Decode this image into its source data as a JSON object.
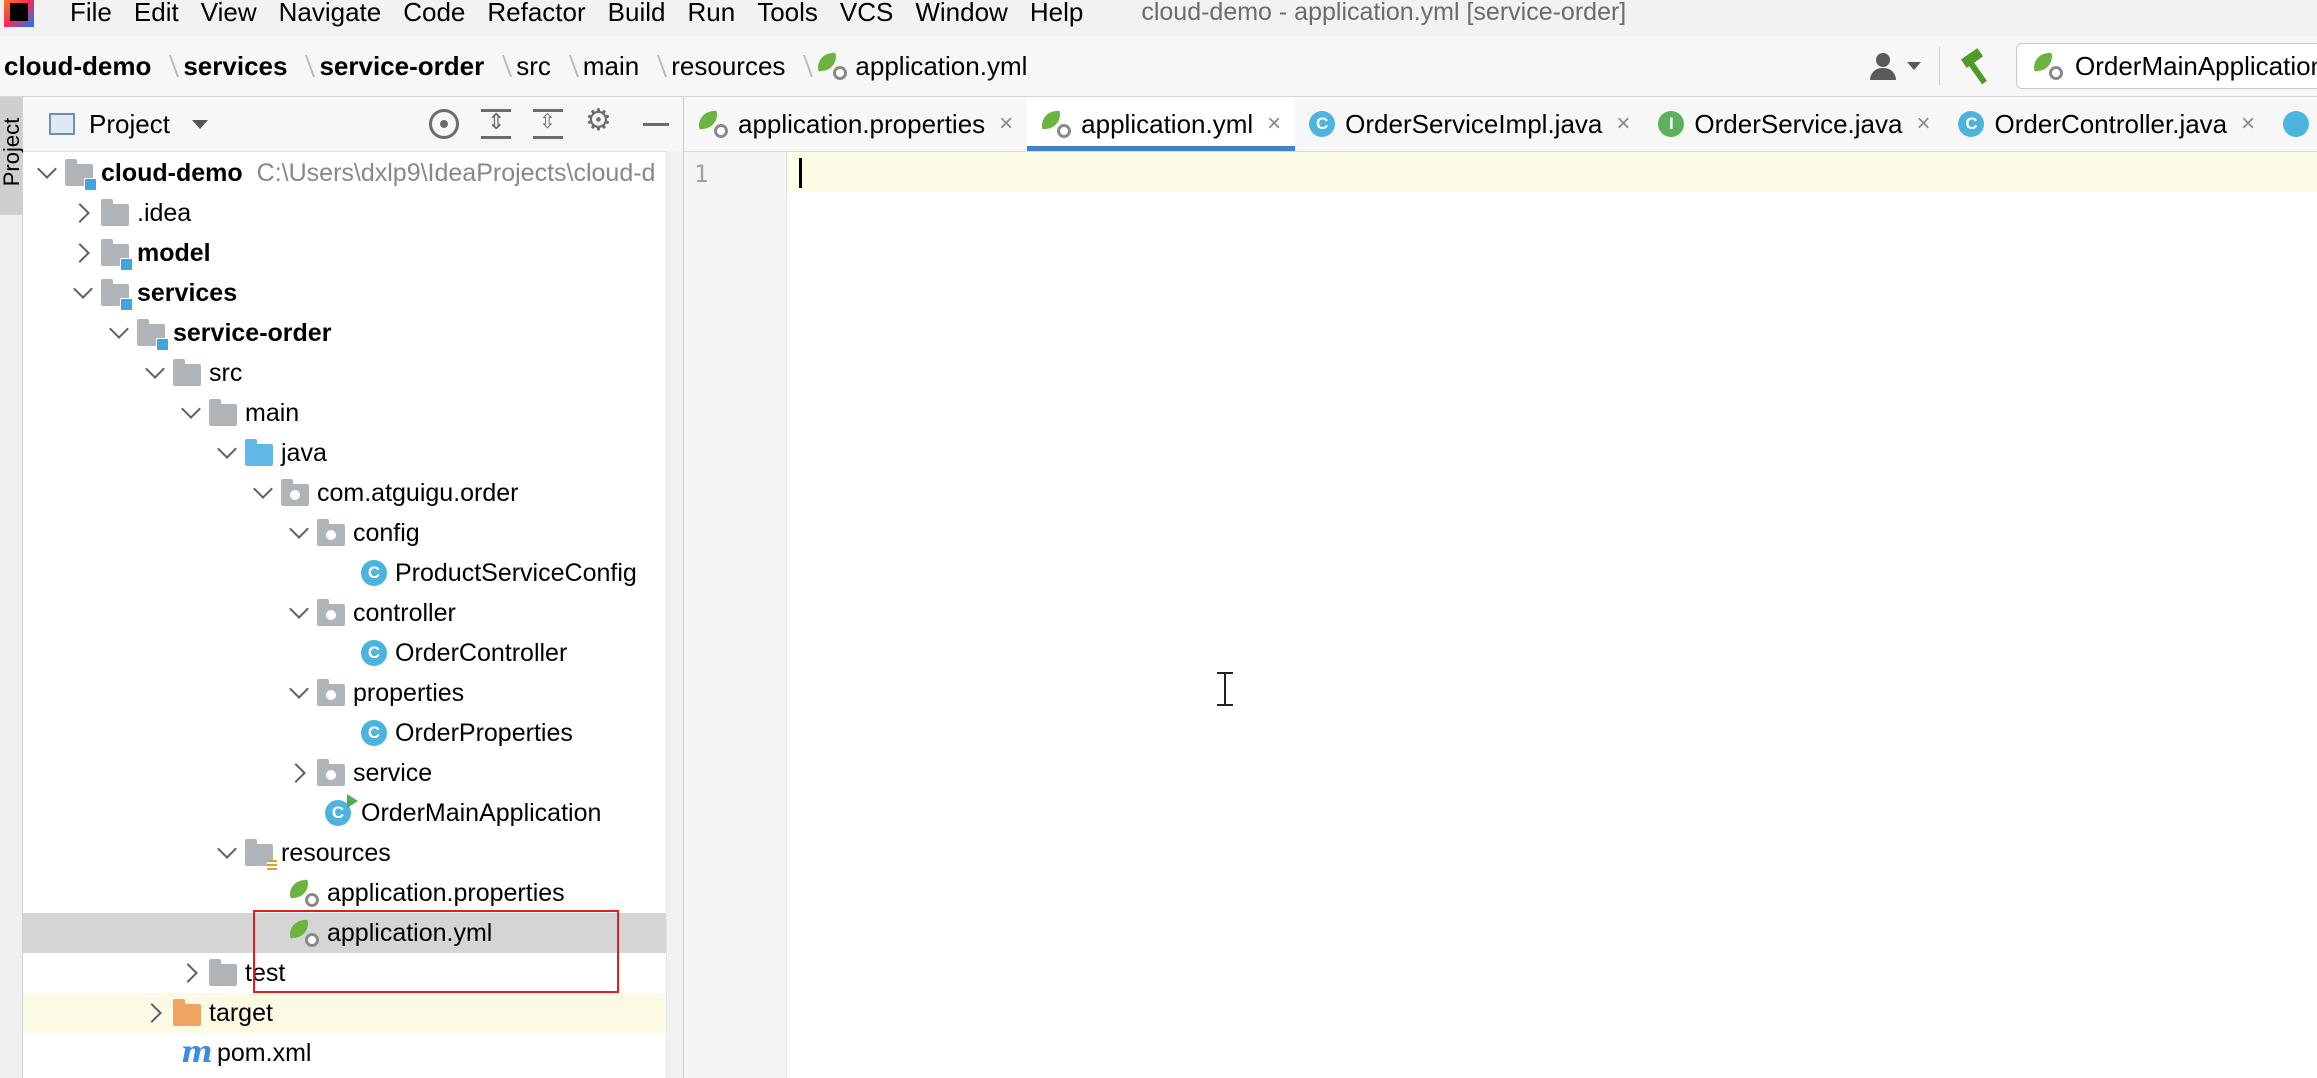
{
  "menu": {
    "items": [
      "File",
      "Edit",
      "View",
      "Navigate",
      "Code",
      "Refactor",
      "Build",
      "Run",
      "Tools",
      "VCS",
      "Window",
      "Help"
    ],
    "window_title": "cloud-demo - application.yml [service-order]"
  },
  "breadcrumb": [
    {
      "label": "cloud-demo",
      "bold": true
    },
    {
      "label": "services",
      "bold": true
    },
    {
      "label": "service-order",
      "bold": true
    },
    {
      "label": "src",
      "bold": false
    },
    {
      "label": "main",
      "bold": false
    },
    {
      "label": "resources",
      "bold": false
    },
    {
      "label": "application.yml",
      "bold": false,
      "icon": "spring-config-icon"
    }
  ],
  "toolbar": {
    "run_config": "OrderMainApplication",
    "user_icon": "user-icon",
    "build_icon": "hammer-icon"
  },
  "project_panel": {
    "stripe_label": "Project",
    "title": "Project",
    "tree": [
      {
        "label": "cloud-demo",
        "bold": true,
        "path": "C:\\Users\\dxlp9\\IdeaProjects\\cloud-d"
      },
      {
        "label": ".idea"
      },
      {
        "label": "model",
        "bold": true
      },
      {
        "label": "services",
        "bold": true
      },
      {
        "label": "service-order",
        "bold": true
      },
      {
        "label": "src"
      },
      {
        "label": "main"
      },
      {
        "label": "java"
      },
      {
        "label": "com.atguigu.order"
      },
      {
        "label": "config"
      },
      {
        "label": "ProductServiceConfig"
      },
      {
        "label": "controller"
      },
      {
        "label": "OrderController"
      },
      {
        "label": "properties"
      },
      {
        "label": "OrderProperties"
      },
      {
        "label": "service"
      },
      {
        "label": "OrderMainApplication"
      },
      {
        "label": "resources"
      },
      {
        "label": "application.properties"
      },
      {
        "label": "application.yml",
        "selected": true
      },
      {
        "label": "test"
      },
      {
        "label": "target"
      },
      {
        "label": "pom.xml"
      }
    ]
  },
  "editor": {
    "tabs": [
      {
        "label": "application.properties",
        "icon": "spring-config-icon"
      },
      {
        "label": "application.yml",
        "icon": "spring-config-icon",
        "active": true
      },
      {
        "label": "OrderServiceImpl.java",
        "icon": "class-icon",
        "icon_letter": "C"
      },
      {
        "label": "OrderService.java",
        "icon": "interface-icon",
        "icon_letter": "I"
      },
      {
        "label": "OrderController.java",
        "icon": "class-icon",
        "icon_letter": "C"
      }
    ],
    "close_glyph": "×",
    "line_numbers": [
      "1"
    ],
    "content": ""
  },
  "colors": {
    "accent": "#4083c9",
    "selection": "#d5d5d5",
    "highlight_box": "#e02020",
    "current_line": "#fdfce6"
  }
}
